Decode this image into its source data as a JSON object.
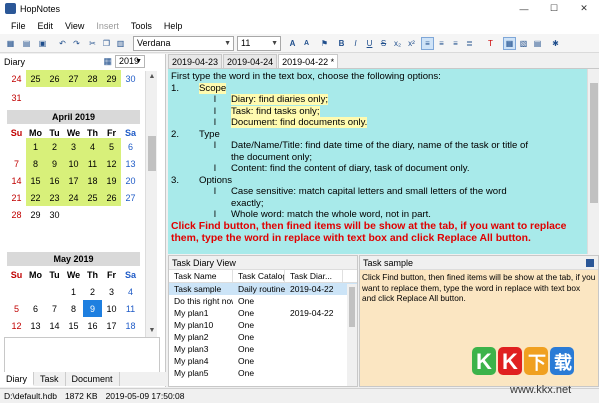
{
  "window": {
    "title": "HopNotes",
    "minimize": "—",
    "maximize": "☐",
    "close": "✕"
  },
  "menu": [
    "File",
    "Edit",
    "View",
    "Insert",
    "Tools",
    "Help"
  ],
  "toolbar": {
    "font": "Verdana",
    "size": "11"
  },
  "diary": {
    "label": "Diary",
    "year": "2019",
    "prev_rows": [
      [
        "24",
        "25",
        "26",
        "27",
        "28",
        "29",
        "30"
      ],
      [
        "31",
        "",
        "",
        "",
        "",
        "",
        ""
      ]
    ],
    "april": {
      "title": "April 2019",
      "dow": [
        "Su",
        "Mo",
        "Tu",
        "We",
        "Th",
        "Fr",
        "Sa"
      ],
      "rows": [
        [
          "",
          "1",
          "2",
          "3",
          "4",
          "5",
          "6"
        ],
        [
          "7",
          "8",
          "9",
          "10",
          "11",
          "12",
          "13"
        ],
        [
          "14",
          "15",
          "16",
          "17",
          "18",
          "19",
          "20"
        ],
        [
          "21",
          "22",
          "23",
          "24",
          "25",
          "26",
          "27"
        ],
        [
          "28",
          "29",
          "30",
          "",
          "",
          "",
          ""
        ]
      ]
    },
    "may": {
      "title": "May 2019",
      "dow": [
        "Su",
        "Mo",
        "Tu",
        "We",
        "Th",
        "Fr",
        "Sa"
      ],
      "rows": [
        [
          "",
          "",
          "",
          "1",
          "2",
          "3",
          "4"
        ],
        [
          "5",
          "6",
          "7",
          "8",
          "9",
          "10",
          "11"
        ],
        [
          "12",
          "13",
          "14",
          "15",
          "16",
          "17",
          "18"
        ]
      ]
    }
  },
  "left_tabs": [
    "Diary",
    "Task",
    "Document"
  ],
  "doc_tabs": [
    "2019-04-23",
    "2019-04-24",
    "2019-04-22 *"
  ],
  "editor": {
    "l1": "First type the word in the text box, choose the following options:",
    "l2_num": "1.",
    "l2": "Scope",
    "l3": "Diary: find diaries only;",
    "l4": "Task: find tasks only;",
    "l5": "Document: find documents only.",
    "l6_num": "2.",
    "l6": "Type",
    "l7": "Date/Name/Title: find date time of the diary, name of the task or title of",
    "l8": "the document only;",
    "l9": "Content: find the content of diary, task of document only.",
    "l10_num": "3.",
    "l10": "Options",
    "l11": "Case sensitive: match capital letters and small letters of the word",
    "l12": "exactly;",
    "l13": "Whole word: match the whole word, not in part.",
    "bullet": "l",
    "red": "Click Find button, then fined items will be show at the tab, if you want to replace them, type the word in replace with text box and click Replace All button."
  },
  "task_diary": {
    "title": "Task Diary View",
    "columns": [
      "Task Name",
      "Task Catalog",
      "Task Diar..."
    ],
    "rows": [
      [
        "Task sample",
        "Daily routine",
        "2019-04-22"
      ],
      [
        "Do this right now",
        "One",
        ""
      ],
      [
        "My plan1",
        "One",
        "2019-04-22"
      ],
      [
        "My plan10",
        "One",
        ""
      ],
      [
        "My plan2",
        "One",
        ""
      ],
      [
        "My plan3",
        "One",
        ""
      ],
      [
        "My plan4",
        "One",
        ""
      ],
      [
        "My plan5",
        "One",
        ""
      ]
    ]
  },
  "task_sample": {
    "title": "Task sample",
    "body": "Click Find button, then fined items will be show at the tab, if you want to replace them, type the word in replace with text box and click Replace All button."
  },
  "status": {
    "db": "D:\\default.hdb",
    "size": "1872 KB",
    "datetime": "2019-05-09 17:50:08"
  },
  "watermark": {
    "brand": "KK下载",
    "url": "www.kkx.net"
  },
  "colors": {
    "highlight_day": "#d8f07a",
    "today": "#1e7fe0",
    "editor_bg": "#a8eaea",
    "task_bg": "#fbe6c2"
  }
}
